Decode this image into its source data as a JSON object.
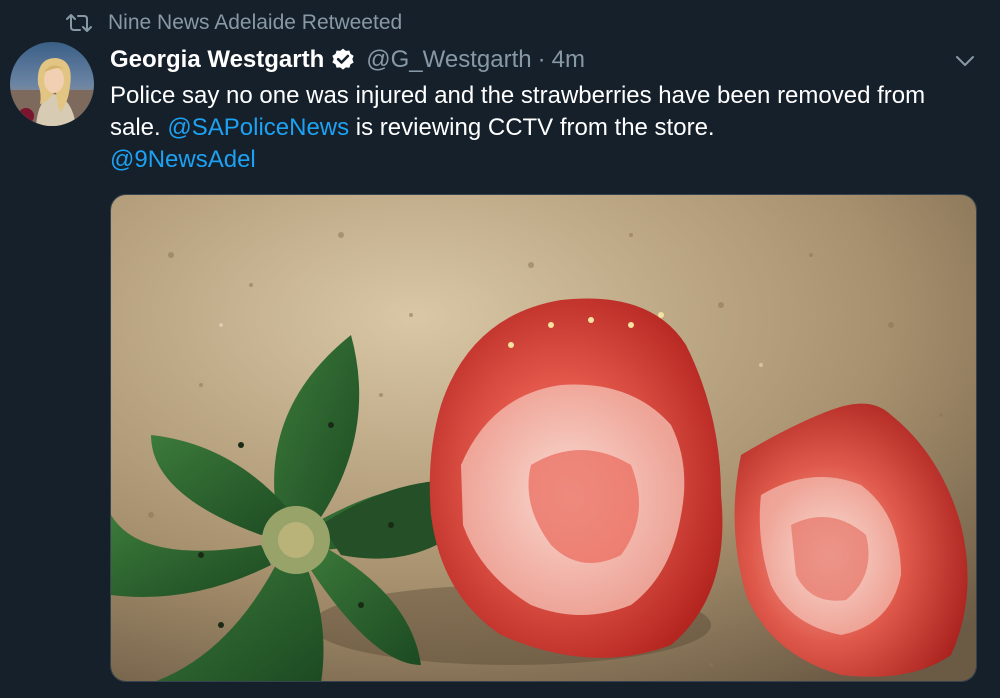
{
  "retweet": {
    "icon": "retweet-icon",
    "text": "Nine News Adelaide Retweeted"
  },
  "author": {
    "avatar": "avatar",
    "name": "Georgia Westgarth",
    "verified_icon": "verified-badge-icon",
    "handle": "@G_Westgarth",
    "separator": "·",
    "time": "4m"
  },
  "menu": {
    "icon": "chevron-down-icon"
  },
  "tweet": {
    "text_part1": "Police say no one was injured and the strawberries have been removed from sale. ",
    "mention1": "@SAPoliceNews",
    "text_part2": " is reviewing CCTV from the store.",
    "mention2": "@9NewsAdel"
  },
  "media": {
    "description_icon": "photo"
  },
  "colors": {
    "background": "#15202b",
    "text": "#ffffff",
    "secondary": "#8899a6",
    "link": "#1da1f2"
  }
}
